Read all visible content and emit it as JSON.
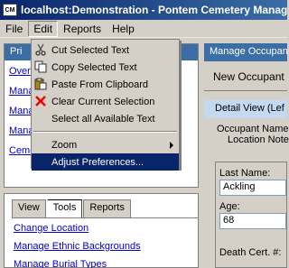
{
  "window": {
    "title": "localhost:Demonstration - Pontem Cemetery Manag",
    "icon": "cm-app-icon"
  },
  "menubar": {
    "items": [
      "File",
      "Edit",
      "Reports",
      "Help"
    ]
  },
  "edit_menu": {
    "items": [
      {
        "label": "Cut Selected Text",
        "icon": "scissors-icon"
      },
      {
        "label": "Copy Selected Text",
        "icon": "copy-icon"
      },
      {
        "label": "Paste From Clipboard",
        "icon": "paste-icon"
      },
      {
        "label": "Clear Current Selection",
        "icon": "red-x-icon"
      },
      {
        "label": "Select all Available Text",
        "icon": ""
      },
      {
        "label": "Zoom",
        "icon": "chevron-right-icon"
      },
      {
        "label": "Adjust Preferences...",
        "icon": ""
      }
    ]
  },
  "left_panel": {
    "header": "Pri",
    "links": [
      "Over",
      "Mana",
      "Mana",
      "Mana",
      "Ceme"
    ]
  },
  "right_panel": {
    "header": "Manage Occupan",
    "new_occupant": "New Occupant",
    "detail_view": "Detail View (Lef",
    "occupant_name_label": "Occupant Name",
    "location_note_label": "Location Note",
    "last_name_label": "Last Name:",
    "last_name_value": "Ackling",
    "age_label": "Age:",
    "age_value": "68",
    "death_cert_label": "Death Cert. #:"
  },
  "bottom_panel": {
    "tabs": [
      "View",
      "Tools",
      "Reports"
    ],
    "selected_tab": "Tools",
    "links": [
      "Change Location",
      "Manage Ethnic Backgrounds",
      "Manage Burial Types"
    ]
  },
  "colors": {
    "titlebar": "#0a246a",
    "highlight": "#0a246a",
    "link": "#0000cc",
    "panel_header": "#3a6ea5"
  }
}
